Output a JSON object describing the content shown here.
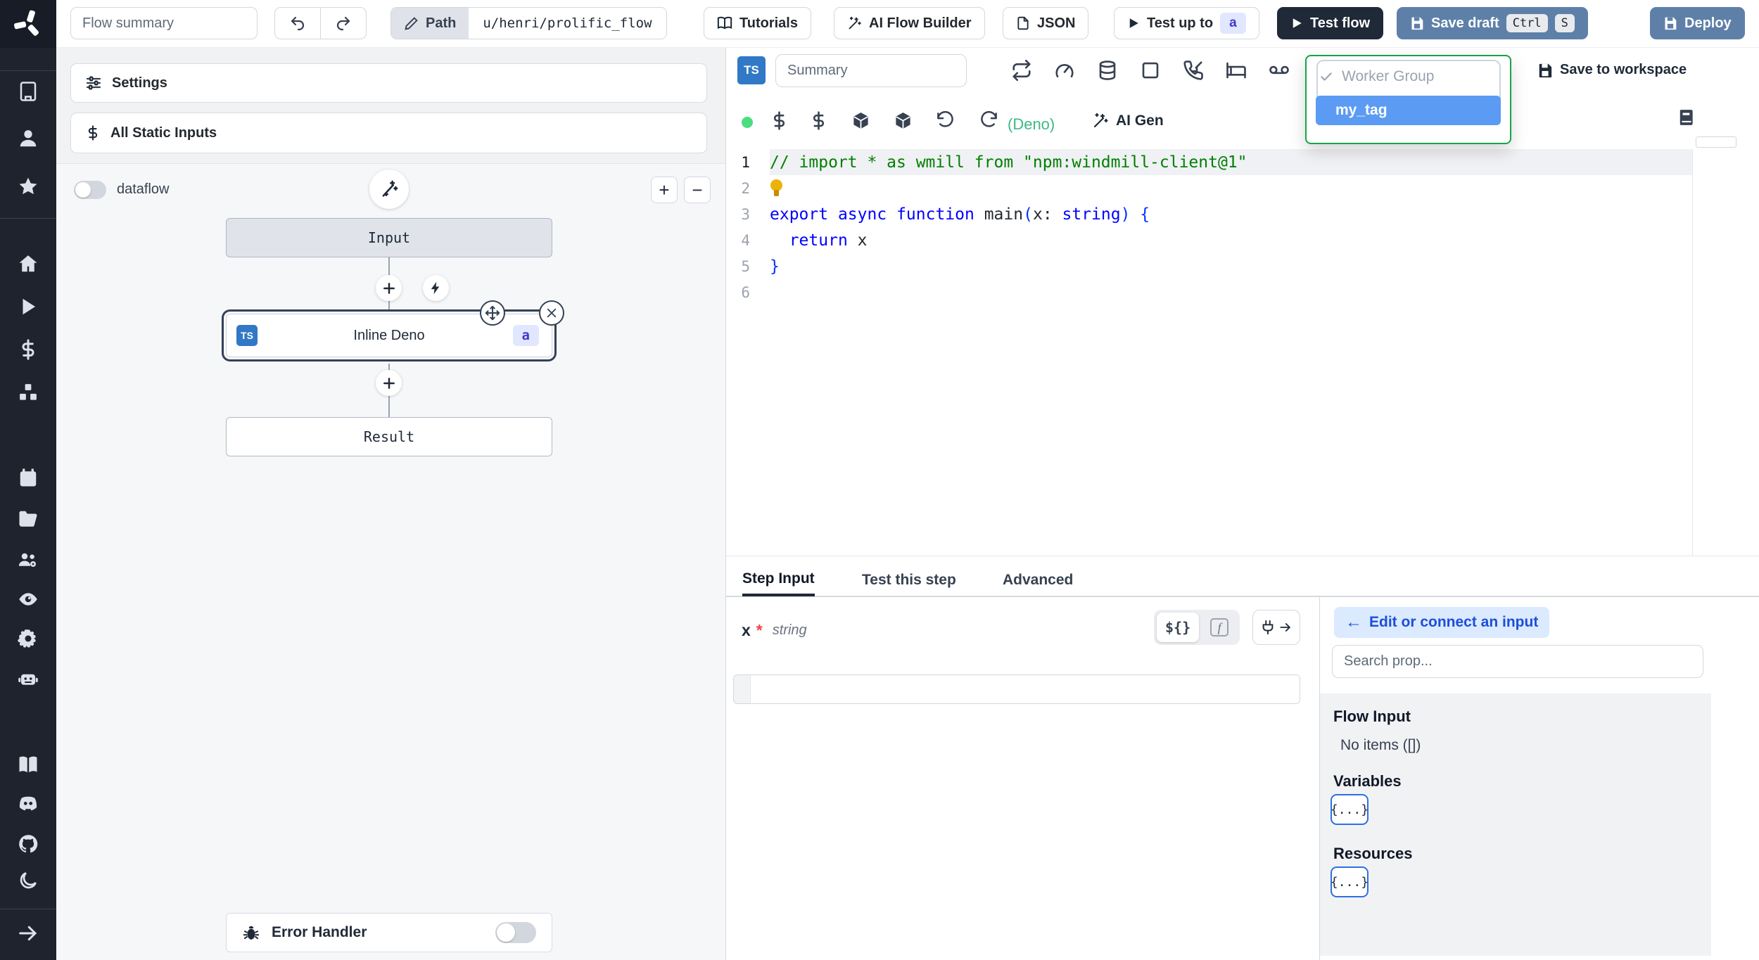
{
  "colors": {
    "sidebar_bg": "#1e232e",
    "accent_steel_blue": "#5e80a8",
    "dark_button": "#1f2937",
    "ts_badge_blue": "#3178c6",
    "badge_lavender_bg": "#e0e7ff",
    "badge_lavender_text": "#4338ca",
    "dropdown_border_green": "#16a34a",
    "selected_tag_bg": "#5b9bf3",
    "deno_green": "#3cba83",
    "status_dot_green": "#4ade80",
    "comment_green": "#008000",
    "keyword_blue": "#0000ff"
  },
  "sidebar": {
    "icon_names": [
      "windmill-logo",
      "building",
      "user",
      "star",
      "home",
      "runs-play",
      "variables-dollar",
      "resources-cubes",
      "schedules-calendar",
      "folders",
      "workers",
      "audit-eye",
      "settings-gear",
      "ai-robot",
      "docs-book",
      "discord",
      "github",
      "dark-mode-moon",
      "collapse-arrow-right"
    ]
  },
  "topbar": {
    "flow_summary_placeholder": "Flow summary",
    "path": {
      "label": "Path",
      "value": "u/henri/prolific_flow"
    },
    "tutorials_label": "Tutorials",
    "ai_flow_builder_label": "AI Flow Builder",
    "json_label": "JSON",
    "test_up_to_label": "Test up to",
    "test_up_to_step": "a",
    "test_flow_label": "Test flow",
    "save_draft_label": "Save draft",
    "save_draft_kbd": [
      "Ctrl",
      "S"
    ],
    "deploy_label": "Deploy"
  },
  "flow_panel": {
    "settings_label": "Settings",
    "all_static_inputs_label": "All Static Inputs",
    "dataflow_label": "dataflow",
    "zoom_in_label": "+",
    "zoom_out_label": "−",
    "input_node_label": "Input",
    "step_node": {
      "lang_badge": "TS",
      "label": "Inline Deno",
      "id_badge": "a"
    },
    "result_node_label": "Result",
    "error_handler_label": "Error Handler"
  },
  "editor": {
    "lang_badge": "TS",
    "summary_placeholder": "Summary",
    "language_hint": "(Deno)",
    "ai_gen_label": "AI Gen",
    "worker_group_dropdown": {
      "group_label": "Worker Group",
      "selected_tag": "my_tag"
    },
    "save_to_workspace_label": "Save to workspace",
    "code_lines": [
      {
        "num": "1",
        "active": true,
        "tokens": [
          {
            "c": "comment",
            "t": "// import * as wmill from \"npm:windmill-client@1\""
          }
        ]
      },
      {
        "num": "2",
        "tokens": [
          {
            "c": "bulb",
            "t": ""
          }
        ]
      },
      {
        "num": "3",
        "tokens": [
          {
            "c": "kw",
            "t": "export"
          },
          {
            "c": "plain",
            "t": " "
          },
          {
            "c": "kw",
            "t": "async"
          },
          {
            "c": "plain",
            "t": " "
          },
          {
            "c": "kw",
            "t": "function"
          },
          {
            "c": "plain",
            "t": " "
          },
          {
            "c": "fn",
            "t": "main"
          },
          {
            "c": "brace",
            "t": "("
          },
          {
            "c": "plain",
            "t": "x"
          },
          {
            "c": "plain",
            "t": ": "
          },
          {
            "c": "kw",
            "t": "string"
          },
          {
            "c": "brace",
            "t": ") {"
          }
        ]
      },
      {
        "num": "4",
        "tokens": [
          {
            "c": "plain",
            "t": "  "
          },
          {
            "c": "kw",
            "t": "return"
          },
          {
            "c": "plain",
            "t": " x"
          }
        ]
      },
      {
        "num": "5",
        "tokens": [
          {
            "c": "brace",
            "t": "}"
          }
        ]
      },
      {
        "num": "6",
        "tokens": []
      }
    ]
  },
  "step_panel": {
    "tabs": [
      "Step Input",
      "Test this step",
      "Advanced"
    ],
    "arg": {
      "name": "x",
      "required_mark": "*",
      "type": "string",
      "value": ""
    },
    "expr_toggle_label": "${}",
    "fn_toggle_label": "f"
  },
  "prop_picker": {
    "back_arrow": "←",
    "back_button_label": "Edit or connect an input",
    "search_placeholder": "Search prop...",
    "flow_input_title": "Flow Input",
    "flow_input_empty": "No items ([])",
    "variables_title": "Variables",
    "variables_chip": "{...}",
    "resources_title": "Resources",
    "resources_chip": "{...}"
  }
}
